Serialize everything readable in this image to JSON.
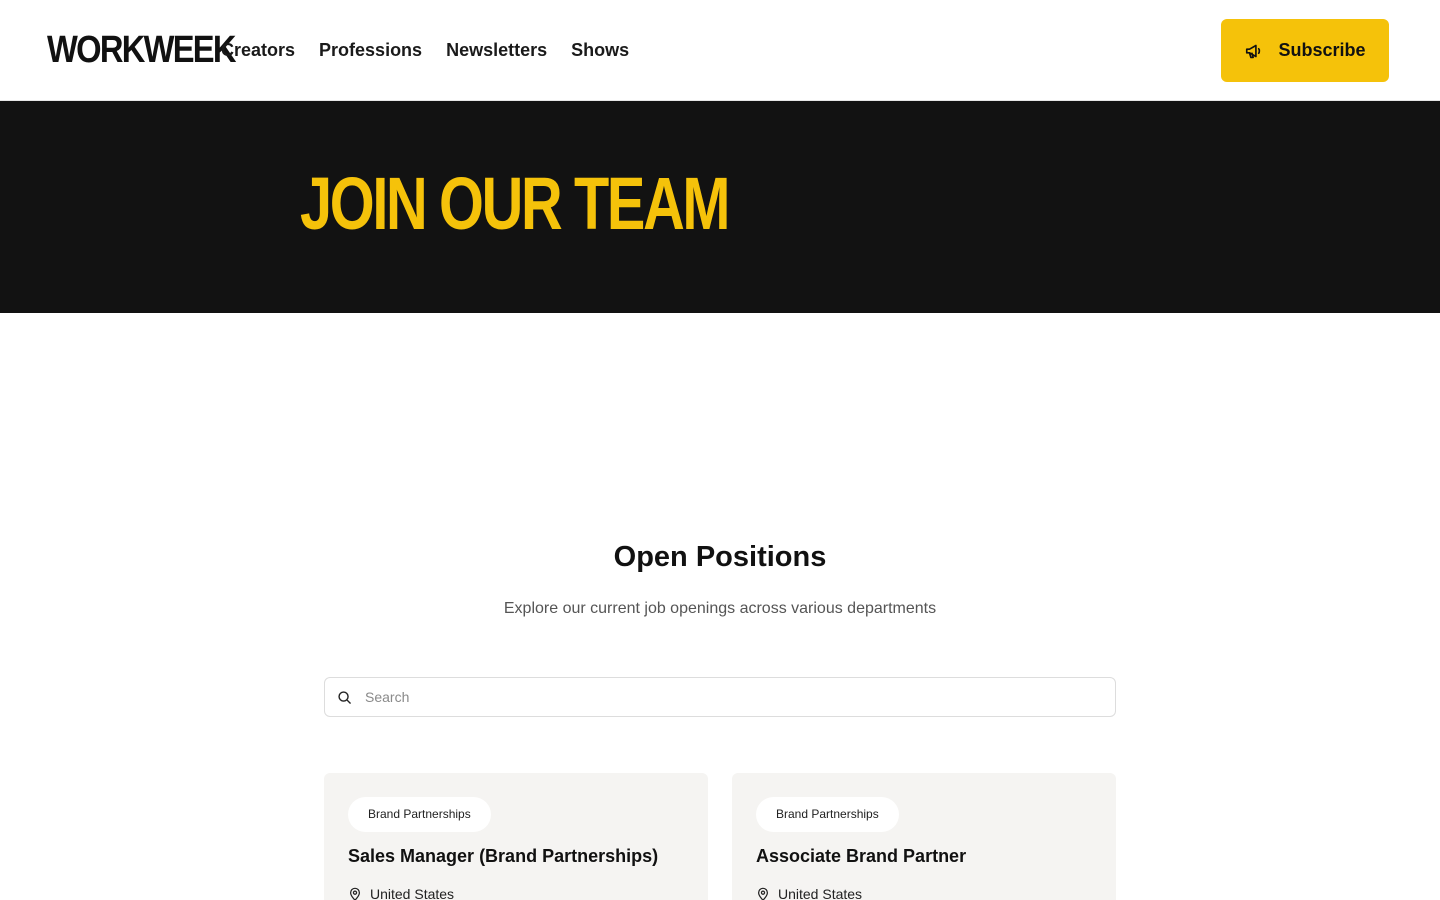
{
  "header": {
    "logo": "WORKWEEK",
    "nav": [
      "Creators",
      "Professions",
      "Newsletters",
      "Shows"
    ],
    "subscribe_label": "Subscribe",
    "subscribe_icon": "megaphone-icon"
  },
  "hero": {
    "title": "JOIN OUR TEAM"
  },
  "positions": {
    "title": "Open Positions",
    "subtitle": "Explore our current job openings across various departments",
    "search_placeholder": "Search",
    "search_icon": "search-icon",
    "jobs": [
      {
        "department": "Brand Partnerships",
        "title": "Sales Manager (Brand Partnerships)",
        "location": "United States"
      },
      {
        "department": "Brand Partnerships",
        "title": "Associate Brand Partner",
        "location": "United States"
      }
    ]
  },
  "colors": {
    "accent": "#f5c20a",
    "hero_bg": "#121212",
    "card_bg": "#f5f4f2"
  }
}
